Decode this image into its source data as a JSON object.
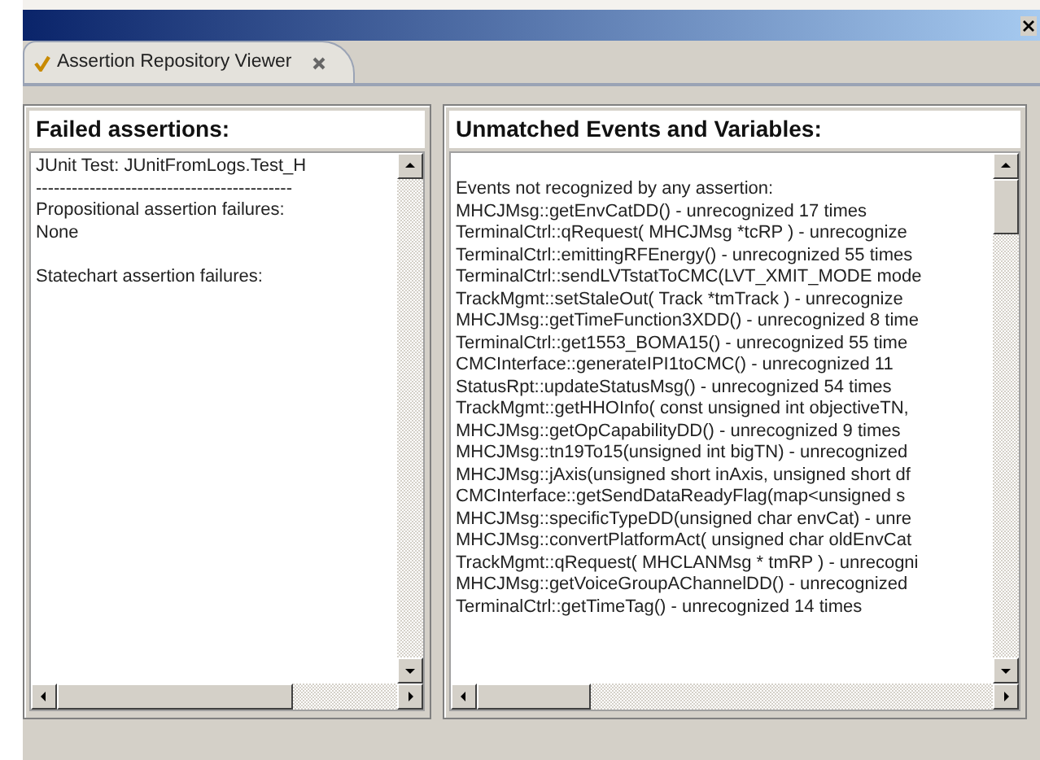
{
  "tab": {
    "label": "Assertion Repository Viewer",
    "selected": true
  },
  "failed_panel": {
    "title": "Failed assertions:",
    "lines": [
      "JUnit Test: JUnitFromLogs.Test_H",
      "-------------------------------------------",
      "Propositional assertion failures:",
      "None",
      "Statechart assertion failures:"
    ]
  },
  "unmatched_panel": {
    "title": "Unmatched Events and Variables:",
    "lines": [
      "Events not recognized by any assertion:",
      "MHCJMsg::getEnvCatDD() - unrecognized 17 times",
      "TerminalCtrl::qRequest( MHCJMsg *tcRP ) - unrecognize",
      "TerminalCtrl::emittingRFEnergy() - unrecognized 55 times",
      "TerminalCtrl::sendLVTstatToCMC(LVT_XMIT_MODE mode",
      "TrackMgmt::setStaleOut( Track *tmTrack ) - unrecognize",
      "MHCJMsg::getTimeFunction3XDD() - unrecognized 8 time",
      "TerminalCtrl::get1553_BOMA15() - unrecognized 55 time",
      "CMCInterface::generateIPI1toCMC() - unrecognized 11",
      "StatusRpt::updateStatusMsg() - unrecognized 54 times",
      "TrackMgmt::getHHOInfo( const unsigned int objectiveTN,",
      "MHCJMsg::getOpCapabilityDD() - unrecognized 9 times",
      "MHCJMsg::tn19To15(unsigned int bigTN) - unrecognized",
      "MHCJMsg::jAxis(unsigned short inAxis, unsigned short df",
      "CMCInterface::getSendDataReadyFlag(map<unsigned s",
      "MHCJMsg::specificTypeDD(unsigned char envCat) - unre",
      "MHCJMsg::convertPlatformAct( unsigned char oldEnvCat",
      "TrackMgmt::qRequest( MHCLANMsg * tmRP ) - unrecogni",
      "MHCJMsg::getVoiceGroupAChannelDD() - unrecognized",
      "TerminalCtrl::getTimeTag() - unrecognized 14 times"
    ]
  }
}
